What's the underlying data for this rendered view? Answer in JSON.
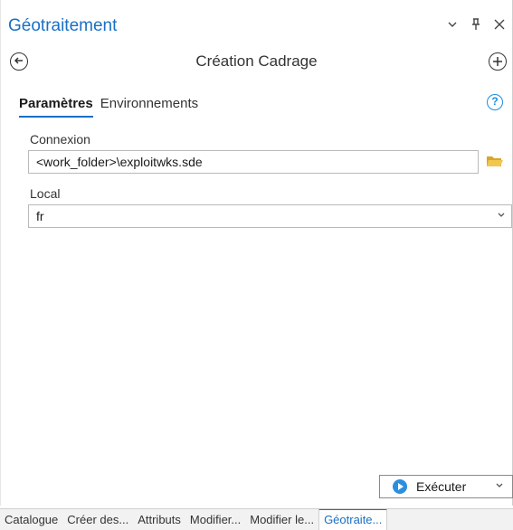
{
  "pane": {
    "title": "Géotraitement",
    "controls": {
      "dropdown_icon": "chevron-down-icon",
      "pin_icon": "pin-icon",
      "close_icon": "close-icon"
    }
  },
  "tool": {
    "title": "Création Cadrage",
    "back_icon": "back-arrow-icon",
    "add_icon": "add-circle-icon"
  },
  "tabs": [
    {
      "label": "Paramètres",
      "active": true
    },
    {
      "label": "Environnements",
      "active": false
    }
  ],
  "parameters": {
    "connexion": {
      "label": "Connexion",
      "value": "<work_folder>\\exploitwks.sde"
    },
    "local": {
      "label": "Local",
      "value": "fr"
    }
  },
  "run_button": {
    "label": "Exécuter"
  },
  "bottom_tabs": [
    {
      "label": "Catalogue",
      "active": false
    },
    {
      "label": "Créer des...",
      "active": false
    },
    {
      "label": "Attributs",
      "active": false
    },
    {
      "label": "Modifier...",
      "active": false
    },
    {
      "label": "Modifier le...",
      "active": false
    },
    {
      "label": "Géotraite...",
      "active": true
    }
  ],
  "colors": {
    "accent": "#1a6fc4",
    "run_icon": "#2b8fe0",
    "folder": "#e8b93a"
  }
}
